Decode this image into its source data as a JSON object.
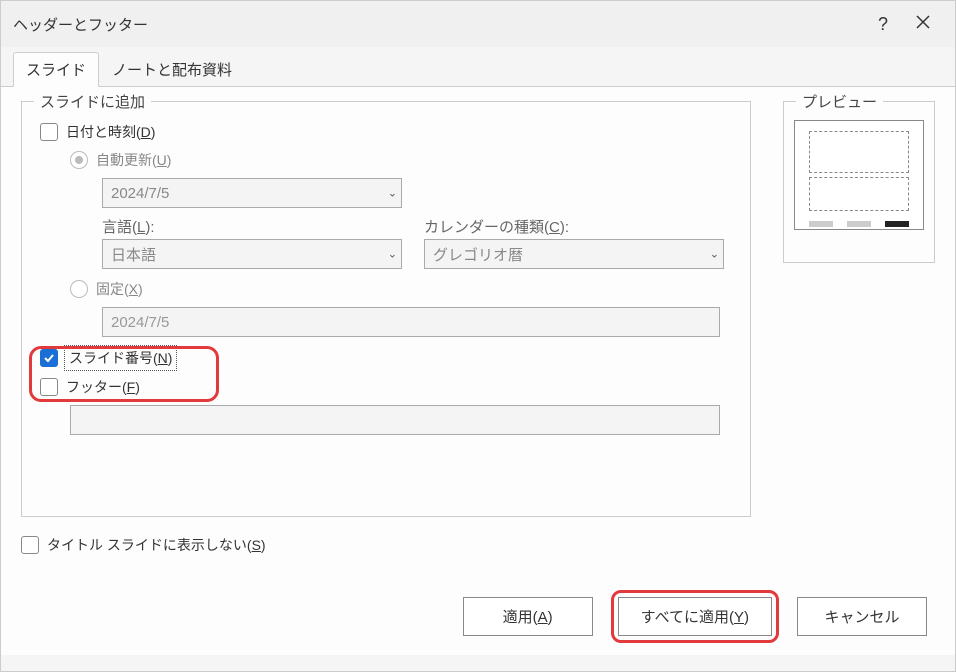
{
  "window": {
    "title": "ヘッダーとフッター"
  },
  "tabs": {
    "slide": "スライド",
    "notes": "ノートと配布資料"
  },
  "group": {
    "addToSlide": "スライドに追加",
    "preview": "プレビュー"
  },
  "dateTime": {
    "label": "日付と時刻(",
    "mn": "D",
    "labelEnd": ")"
  },
  "autoUpdate": {
    "label": "自動更新(",
    "mn": "U",
    "labelEnd": ")",
    "dateValue": "2024/7/5",
    "languageLabel": "言語(",
    "languageMn": "L",
    "languageEnd": "):",
    "languageValue": "日本語",
    "calendarLabel": "カレンダーの種類(",
    "calendarMn": "C",
    "calendarEnd": "):",
    "calendarValue": "グレゴリオ暦"
  },
  "fixed": {
    "label": "固定(",
    "mn": "X",
    "labelEnd": ")",
    "value": "2024/7/5"
  },
  "slideNumber": {
    "label": "スライド番号(",
    "mn": "N",
    "labelEnd": ")"
  },
  "footer": {
    "label": "フッター(",
    "mn": "F",
    "labelEnd": ")",
    "value": ""
  },
  "dontShowTitle": {
    "label": "タイトル スライドに表示しない(",
    "mn": "S",
    "labelEnd": ")"
  },
  "buttons": {
    "apply": "適用(",
    "applyMn": "A",
    "applyEnd": ")",
    "applyAll": "すべてに適用(",
    "applyAllMn": "Y",
    "applyAllEnd": ")",
    "cancel": "キャンセル"
  }
}
